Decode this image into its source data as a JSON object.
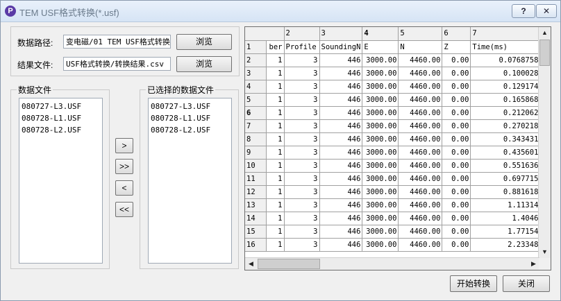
{
  "window": {
    "title": "TEM USF格式转换(*.usf)",
    "help_label": "?",
    "close_label": "✕",
    "icon_letter": "P"
  },
  "paths": {
    "data_path_label": "数据路径:",
    "data_path_value": "变电磁/01 TEM USF格式转换",
    "result_file_label": "结果文件:",
    "result_file_value": "USF格式转换/转换结果.csv",
    "browse_label": "浏览"
  },
  "data_files": {
    "title": "数据文件",
    "items": [
      "080727-L3.USF",
      "080728-L1.USF",
      "080728-L2.USF"
    ]
  },
  "selected_files": {
    "title": "已选择的数据文件",
    "items": [
      "080727-L3.USF",
      "080728-L1.USF",
      "080728-L2.USF"
    ]
  },
  "transfer_buttons": {
    "add": ">",
    "add_all": ">>",
    "remove": "<",
    "remove_all": "<<"
  },
  "grid": {
    "col_numbers": [
      "",
      "2",
      "3",
      "4",
      "5",
      "6",
      "7"
    ],
    "headers": [
      "1",
      "ber",
      "Profile",
      "SoundingN",
      "E",
      "N",
      "Z",
      "Time(ms)"
    ],
    "rows": [
      [
        "2",
        "1",
        "3",
        "446",
        "3000.00",
        "4460.00",
        "0.00",
        "0.0768758"
      ],
      [
        "3",
        "1",
        "3",
        "446",
        "3000.00",
        "4460.00",
        "0.00",
        "0.100028"
      ],
      [
        "4",
        "1",
        "3",
        "446",
        "3000.00",
        "4460.00",
        "0.00",
        "0.129174"
      ],
      [
        "5",
        "1",
        "3",
        "446",
        "3000.00",
        "4460.00",
        "0.00",
        "0.165868"
      ],
      [
        "6",
        "1",
        "3",
        "446",
        "3000.00",
        "4460.00",
        "0.00",
        "0.212062"
      ],
      [
        "7",
        "1",
        "3",
        "446",
        "3000.00",
        "4460.00",
        "0.00",
        "0.270218"
      ],
      [
        "8",
        "1",
        "3",
        "446",
        "3000.00",
        "4460.00",
        "0.00",
        "0.343431"
      ],
      [
        "9",
        "1",
        "3",
        "446",
        "3000.00",
        "4460.00",
        "0.00",
        "0.435601"
      ],
      [
        "10",
        "1",
        "3",
        "446",
        "3000.00",
        "4460.00",
        "0.00",
        "0.551636"
      ],
      [
        "11",
        "1",
        "3",
        "446",
        "3000.00",
        "4460.00",
        "0.00",
        "0.697715"
      ],
      [
        "12",
        "1",
        "3",
        "446",
        "3000.00",
        "4460.00",
        "0.00",
        "0.881618"
      ],
      [
        "13",
        "1",
        "3",
        "446",
        "3000.00",
        "4460.00",
        "0.00",
        "1.11314"
      ],
      [
        "14",
        "1",
        "3",
        "446",
        "3000.00",
        "4460.00",
        "0.00",
        "1.4046"
      ],
      [
        "15",
        "1",
        "3",
        "446",
        "3000.00",
        "4460.00",
        "0.00",
        "1.77154"
      ],
      [
        "16",
        "1",
        "3",
        "446",
        "3000.00",
        "4460.00",
        "0.00",
        "2.23348"
      ]
    ]
  },
  "footer": {
    "start_label": "开始转换",
    "close_label": "关闭"
  }
}
